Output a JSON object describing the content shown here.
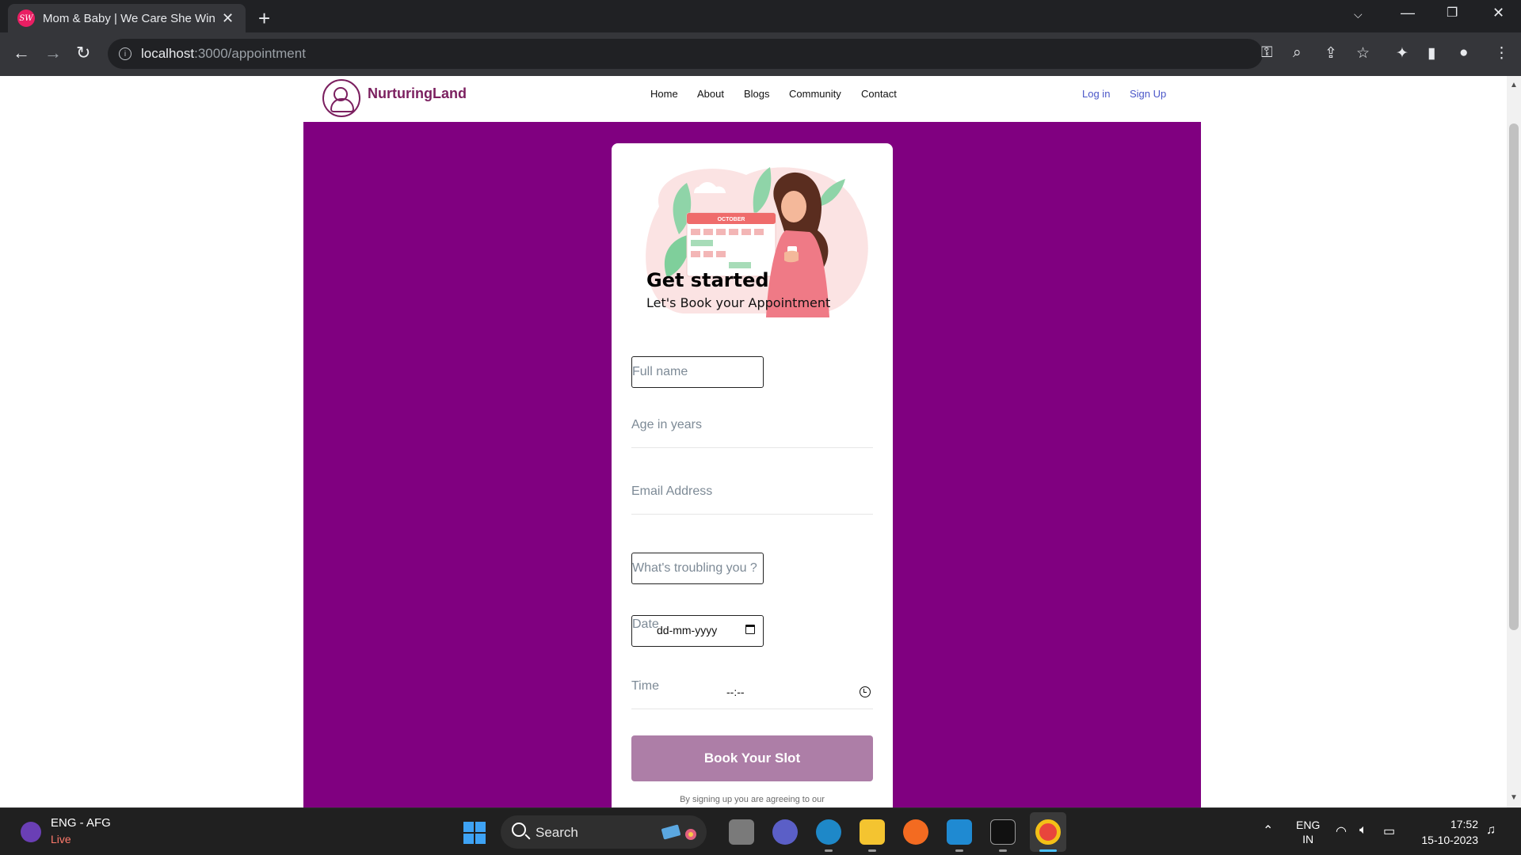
{
  "browser": {
    "tab_title": "Mom & Baby | We Care She Win",
    "favicon_text": "SW",
    "url_host": "localhost",
    "url_path": ":3000/appointment"
  },
  "site": {
    "logo_text": "NurturingLand",
    "nav": [
      "Home",
      "About",
      "Blogs",
      "Community",
      "Contact"
    ],
    "login": "Log in",
    "signup": "Sign Up",
    "brand_color": "#7b1f5f",
    "band_color": "#800080"
  },
  "form": {
    "title": "Get started",
    "subtitle": "Let's Book your Appointment",
    "calendar_month": "OCTOBER",
    "full_name_ph": "Full name",
    "age_ph": "Age in years",
    "email_ph": "Email Address",
    "trouble_ph": "What's troubling you ?",
    "date_label": "Date",
    "date_value": "dd-mm-yyyy",
    "time_label": "Time",
    "time_value": "--:--",
    "submit": "Book Your Slot",
    "terms": "By signing up you are agreeing to our",
    "button_color": "#ad7ea7"
  },
  "taskbar": {
    "lang": "ENG - AFG",
    "live": "Live",
    "search": "Search",
    "tray_lang_1": "ENG",
    "tray_lang_2": "IN",
    "time": "17:52",
    "date": "15-10-2023"
  }
}
